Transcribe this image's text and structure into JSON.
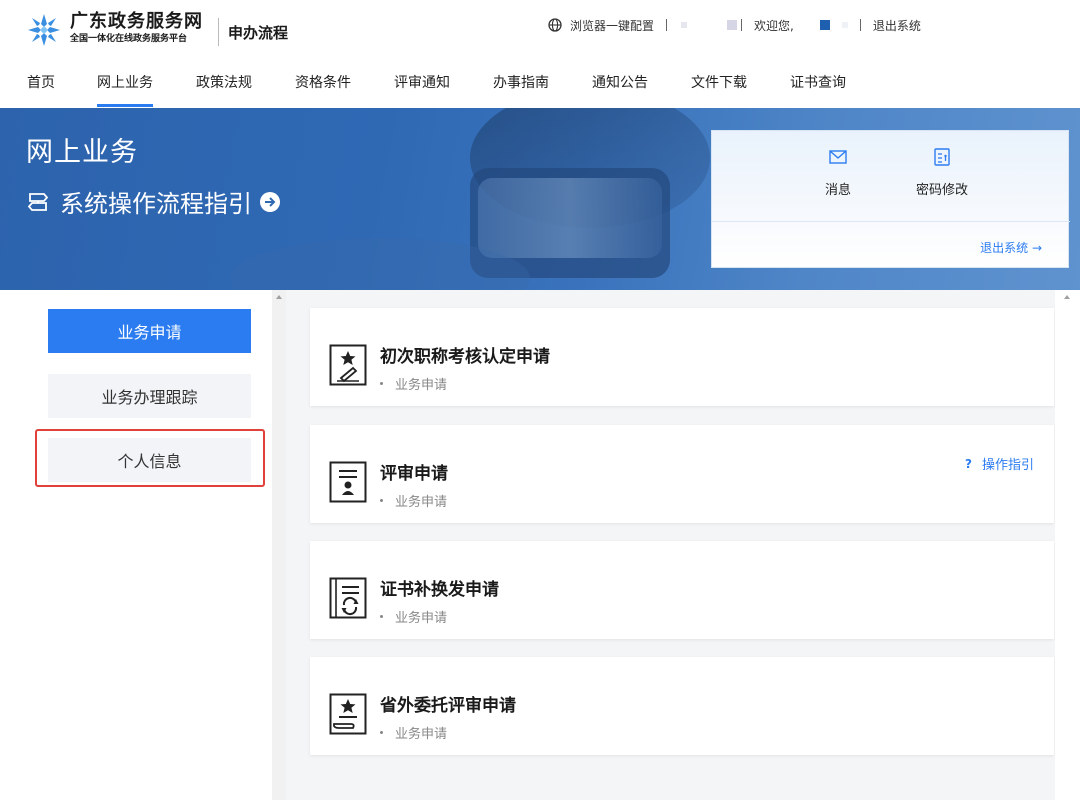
{
  "header": {
    "site_title": "广东政务服务网",
    "site_subtitle": "全国一体化在线政务服务平台",
    "section_title": "申办流程",
    "browser_config": "浏览器一键配置",
    "welcome": "欢迎您,",
    "logout": "退出系统"
  },
  "nav": {
    "items": [
      "首页",
      "网上业务",
      "政策法规",
      "资格条件",
      "评审通知",
      "办事指南",
      "通知公告",
      "文件下载",
      "证书查询"
    ],
    "active": "网上业务"
  },
  "banner": {
    "title": "网上业务",
    "guide_link": "系统操作流程指引"
  },
  "user_card": {
    "message": "消息",
    "change_password": "密码修改",
    "logout": "退出系统 →"
  },
  "sidebar": {
    "items": [
      "业务申请",
      "业务办理跟踪",
      "个人信息"
    ],
    "active": "业务申请"
  },
  "services": [
    {
      "title": "初次职称考核认定申请",
      "tag": "业务申请",
      "icon": "star-certificate-icon"
    },
    {
      "title": "评审申请",
      "tag": "业务申请",
      "icon": "id-document-icon",
      "help": "操作指引"
    },
    {
      "title": "证书补换发申请",
      "tag": "业务申请",
      "icon": "certificate-renew-icon"
    },
    {
      "title": "省外委托评审申请",
      "tag": "业务申请",
      "icon": "star-hand-icon"
    }
  ],
  "colors": {
    "primary": "#2b7cf0",
    "banner": "#2f69b4",
    "highlight": "#e0413a"
  }
}
